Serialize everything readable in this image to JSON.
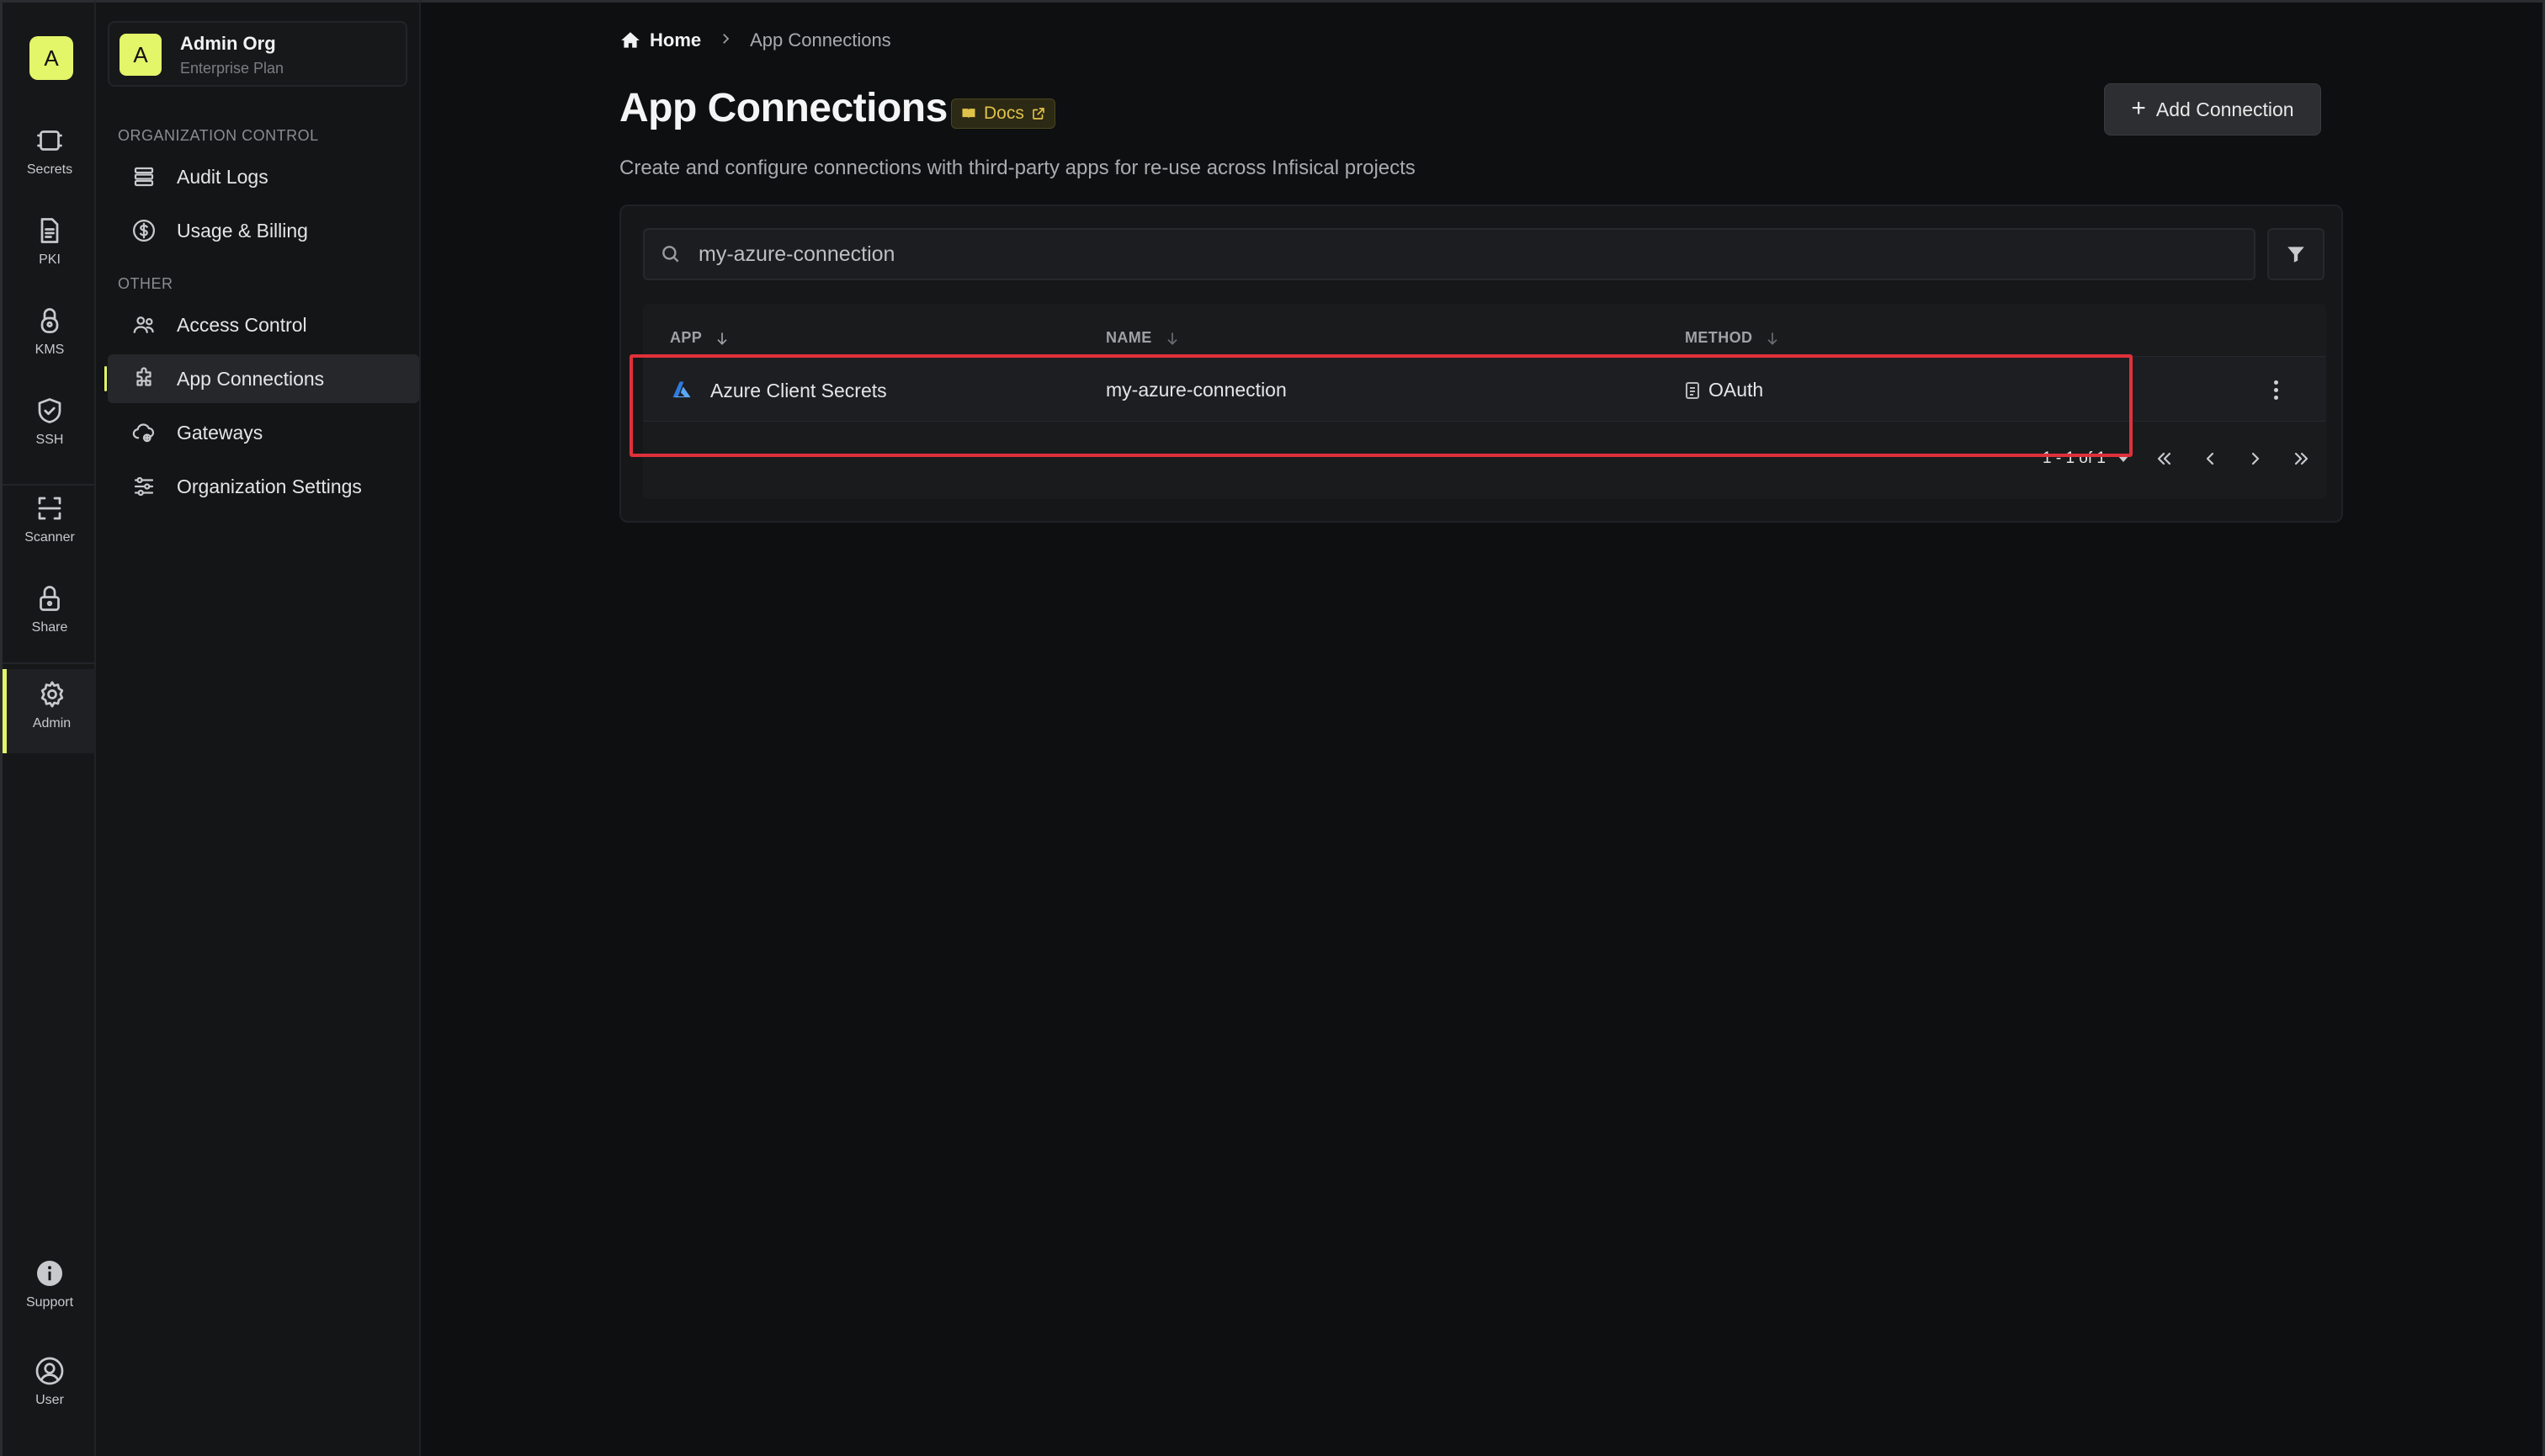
{
  "rail": {
    "logo": "A",
    "items": [
      {
        "label": "Secrets"
      },
      {
        "label": "PKI"
      },
      {
        "label": "KMS"
      },
      {
        "label": "SSH"
      },
      {
        "label": "Scanner"
      },
      {
        "label": "Share"
      },
      {
        "label": "Admin"
      },
      {
        "label": "Support"
      },
      {
        "label": "User"
      }
    ]
  },
  "org": {
    "avatar": "A",
    "name": "Admin Org",
    "plan": "Enterprise Plan"
  },
  "sidebar": {
    "section_org": "ORGANIZATION CONTROL",
    "section_other": "OTHER",
    "items": [
      {
        "label": "Audit Logs"
      },
      {
        "label": "Usage & Billing"
      },
      {
        "label": "Access Control"
      },
      {
        "label": "App Connections"
      },
      {
        "label": "Gateways"
      },
      {
        "label": "Organization Settings"
      }
    ]
  },
  "breadcrumb": {
    "home": "Home",
    "current": "App Connections"
  },
  "page": {
    "title": "App Connections",
    "docs_label": "Docs",
    "subtitle": "Create and configure connections with third-party apps for re-use across Infisical projects",
    "add_button": "Add Connection"
  },
  "search": {
    "value": "my-azure-connection"
  },
  "table": {
    "columns": [
      "APP",
      "NAME",
      "METHOD"
    ],
    "rows": [
      {
        "app": "Azure Client Secrets",
        "name": "my-azure-connection",
        "method": "OAuth"
      }
    ]
  },
  "pagination": {
    "range": "1 - 1 of 1"
  },
  "colors": {
    "accent": "#e3f569",
    "highlight": "#e0313a",
    "background": "#0e0f11"
  }
}
